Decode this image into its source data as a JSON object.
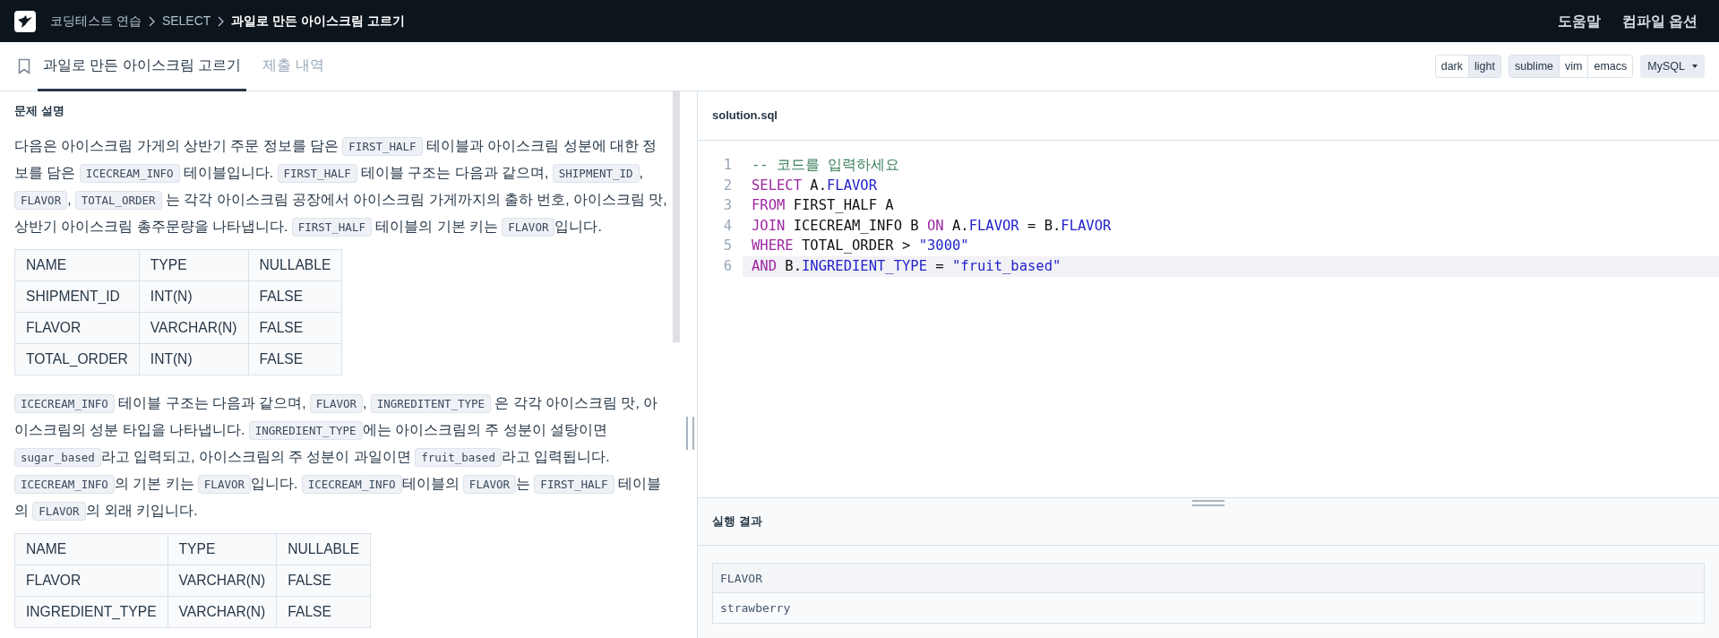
{
  "header": {
    "breadcrumb": [
      "코딩테스트 연습",
      "SELECT"
    ],
    "title": "과일로 만든 아이스크림 고르기",
    "links": [
      "도움말",
      "컴파일 옵션"
    ]
  },
  "tabs": [
    {
      "label": "과일로 만든 아이스크림 고르기",
      "selected": true
    },
    {
      "label": "제출 내역",
      "selected": false
    }
  ],
  "toolbar": {
    "groups": [
      [
        {
          "label": "dark",
          "selected": false
        },
        {
          "label": "light",
          "selected": true
        }
      ],
      [
        {
          "label": "sublime",
          "selected": true
        },
        {
          "label": "vim",
          "selected": false
        },
        {
          "label": "emacs",
          "selected": false
        }
      ]
    ],
    "language": "MySQL"
  },
  "description": {
    "heading": "문제 설명",
    "blocks": [
      {
        "kind": "paragraph",
        "segments": [
          {
            "kind": "text",
            "text": "다음은 아이스크림 가게의 상반기 주문 정보를 담은 "
          },
          {
            "kind": "code",
            "text": "FIRST_HALF"
          },
          {
            "kind": "text",
            "text": " 테이블과 아이스크림 성분에 대한 정보를 담은 "
          },
          {
            "kind": "code",
            "text": "ICECREAM_INFO"
          },
          {
            "kind": "text",
            "text": " 테이블입니다. "
          },
          {
            "kind": "code",
            "text": "FIRST_HALF"
          },
          {
            "kind": "text",
            "text": " 테이블 구조는 다음과 같으며, "
          },
          {
            "kind": "code",
            "text": "SHIPMENT_ID"
          },
          {
            "kind": "text",
            "text": ", "
          },
          {
            "kind": "code",
            "text": "FLAVOR"
          },
          {
            "kind": "text",
            "text": ", "
          },
          {
            "kind": "code",
            "text": "TOTAL_ORDER"
          },
          {
            "kind": "text",
            "text": " 는 각각 아이스크림 공장에서 아이스크림 가게까지의 출하 번호, 아이스크림 맛, 상반기 아이스크림 총주문량을 나타냅니다. "
          },
          {
            "kind": "code",
            "text": "FIRST_HALF"
          },
          {
            "kind": "text",
            "text": " 테이블의 기본 키는 "
          },
          {
            "kind": "code",
            "text": "FLAVOR"
          },
          {
            "kind": "text",
            "text": "입니다."
          }
        ]
      },
      {
        "kind": "table",
        "columns": [
          "NAME",
          "TYPE",
          "NULLABLE"
        ],
        "rows": [
          [
            "SHIPMENT_ID",
            "INT(N)",
            "FALSE"
          ],
          [
            "FLAVOR",
            "VARCHAR(N)",
            "FALSE"
          ],
          [
            "TOTAL_ORDER",
            "INT(N)",
            "FALSE"
          ]
        ]
      },
      {
        "kind": "paragraph",
        "segments": [
          {
            "kind": "code",
            "text": "ICECREAM_INFO"
          },
          {
            "kind": "text",
            "text": " 테이블 구조는 다음과 같으며, "
          },
          {
            "kind": "code",
            "text": "FLAVOR"
          },
          {
            "kind": "text",
            "text": ", "
          },
          {
            "kind": "code",
            "text": "INGREDITENT_TYPE"
          },
          {
            "kind": "text",
            "text": " 은 각각 아이스크림 맛, 아이스크림의 성분 타입을 나타냅니다. "
          },
          {
            "kind": "code",
            "text": "INGREDIENT_TYPE"
          },
          {
            "kind": "text",
            "text": "에는 아이스크림의 주 성분이 설탕이면 "
          },
          {
            "kind": "code",
            "text": "sugar_based"
          },
          {
            "kind": "text",
            "text": "라고 입력되고, 아이스크림의 주 성분이 과일이면 "
          },
          {
            "kind": "code",
            "text": "fruit_based"
          },
          {
            "kind": "text",
            "text": "라고 입력됩니다. "
          },
          {
            "kind": "code",
            "text": "ICECREAM_INFO"
          },
          {
            "kind": "text",
            "text": "의 기본 키는 "
          },
          {
            "kind": "code",
            "text": "FLAVOR"
          },
          {
            "kind": "text",
            "text": "입니다. "
          },
          {
            "kind": "code",
            "text": "ICECREAM_INFO"
          },
          {
            "kind": "text",
            "text": "테이블의 "
          },
          {
            "kind": "code",
            "text": "FLAVOR"
          },
          {
            "kind": "text",
            "text": "는 "
          },
          {
            "kind": "code",
            "text": "FIRST_HALF"
          },
          {
            "kind": "text",
            "text": " 테이블의 "
          },
          {
            "kind": "code",
            "text": "FLAVOR"
          },
          {
            "kind": "text",
            "text": "의 외래 키입니다."
          }
        ]
      },
      {
        "kind": "table",
        "columns": [
          "NAME",
          "TYPE",
          "NULLABLE"
        ],
        "rows": [
          [
            "FLAVOR",
            "VARCHAR(N)",
            "FALSE"
          ],
          [
            "INGREDIENT_TYPE",
            "VARCHAR(N)",
            "FALSE"
          ]
        ]
      }
    ]
  },
  "editor": {
    "filename": "solution.sql",
    "lines": [
      {
        "number": "1",
        "active": false,
        "tokens": [
          {
            "kind": "comment",
            "text": "-- 코드를 입력하세요"
          }
        ]
      },
      {
        "number": "2",
        "active": false,
        "tokens": [
          {
            "kind": "keyword",
            "text": "SELECT"
          },
          {
            "kind": "plain",
            "text": " A."
          },
          {
            "kind": "field",
            "text": "FLAVOR"
          }
        ]
      },
      {
        "number": "3",
        "active": false,
        "tokens": [
          {
            "kind": "keyword",
            "text": "FROM"
          },
          {
            "kind": "plain",
            "text": " FIRST_HALF A"
          }
        ]
      },
      {
        "number": "4",
        "active": false,
        "tokens": [
          {
            "kind": "keyword",
            "text": "JOIN"
          },
          {
            "kind": "plain",
            "text": " ICECREAM_INFO B "
          },
          {
            "kind": "keyword",
            "text": "ON"
          },
          {
            "kind": "plain",
            "text": " A."
          },
          {
            "kind": "field",
            "text": "FLAVOR"
          },
          {
            "kind": "plain",
            "text": " = B."
          },
          {
            "kind": "field",
            "text": "FLAVOR"
          }
        ]
      },
      {
        "number": "5",
        "active": false,
        "tokens": [
          {
            "kind": "keyword",
            "text": "WHERE"
          },
          {
            "kind": "plain",
            "text": " TOTAL_ORDER > "
          },
          {
            "kind": "string",
            "text": "\"3000\""
          }
        ]
      },
      {
        "number": "6",
        "active": true,
        "tokens": [
          {
            "kind": "keyword",
            "text": "AND"
          },
          {
            "kind": "plain",
            "text": " B."
          },
          {
            "kind": "field",
            "text": "INGREDIENT_TYPE"
          },
          {
            "kind": "plain",
            "text": " = "
          },
          {
            "kind": "string",
            "text": "\"fruit_based\""
          }
        ]
      }
    ]
  },
  "result": {
    "heading": "실행 결과",
    "columns": [
      "FLAVOR"
    ],
    "rows": [
      [
        "strawberry"
      ]
    ]
  }
}
